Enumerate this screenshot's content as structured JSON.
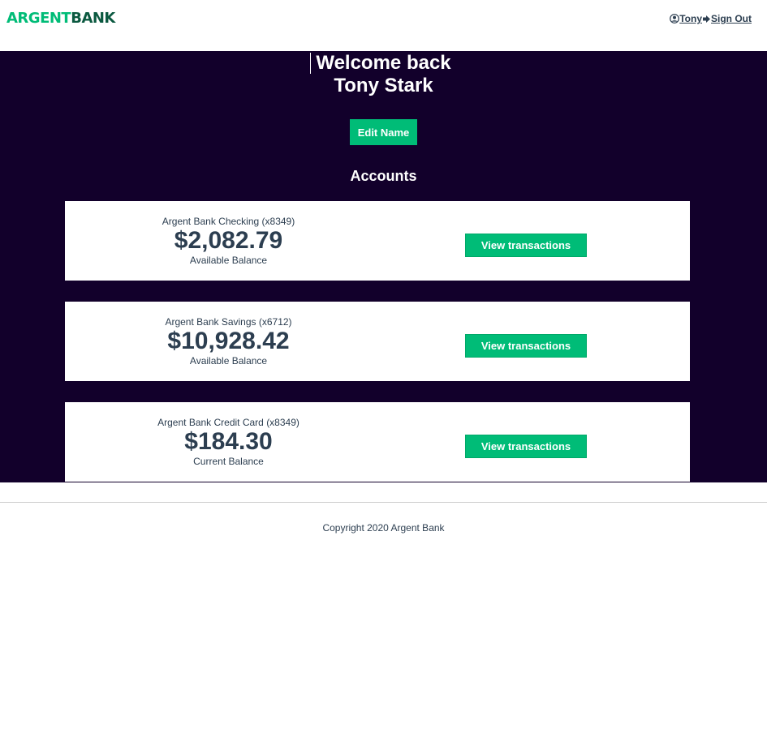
{
  "header": {
    "logo_argent": "ARGENT",
    "logo_bank": "BANK",
    "user_name": "Tony",
    "sign_out": "Sign Out"
  },
  "main": {
    "welcome_line1": "Welcome back",
    "welcome_line2": "Tony Stark",
    "edit_name": "Edit Name",
    "accounts_title": "Accounts",
    "accounts": [
      {
        "title": "Argent Bank Checking (x8349)",
        "amount": "$2,082.79",
        "description": "Available Balance",
        "button": "View transactions"
      },
      {
        "title": "Argent Bank Savings (x6712)",
        "amount": "$10,928.42",
        "description": "Available Balance",
        "button": "View transactions"
      },
      {
        "title": "Argent Bank Credit Card (x8349)",
        "amount": "$184.30",
        "description": "Current Balance",
        "button": "View transactions"
      }
    ]
  },
  "footer": {
    "copyright": "Copyright 2020 Argent Bank"
  },
  "colors": {
    "accent": "#00bc77",
    "brand_dark": "#0b5940",
    "background_dark": "#12002b",
    "text": "#2c3e50"
  },
  "icons": {
    "user": "user-circle-icon",
    "sign_out": "sign-out-icon"
  }
}
